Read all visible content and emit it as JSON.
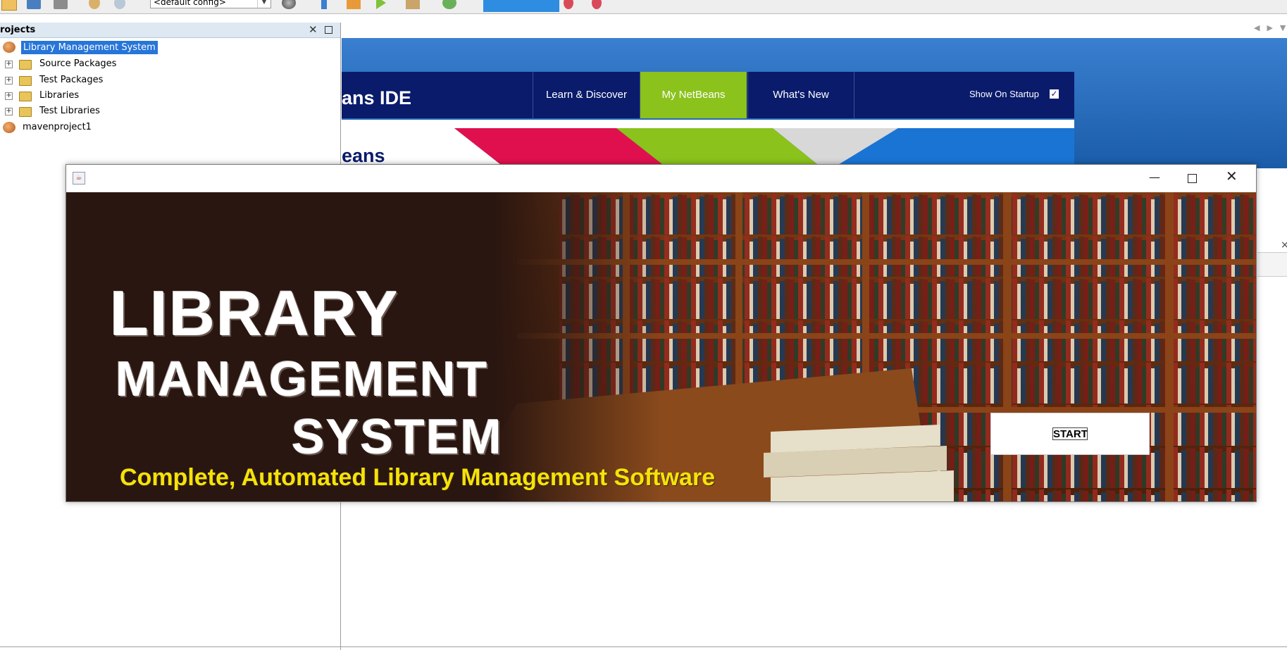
{
  "toolbar": {
    "config_value": "<default config>"
  },
  "projects_panel": {
    "title": "rojects",
    "items": [
      {
        "label": "Library Management System"
      },
      {
        "label": "Source Packages"
      },
      {
        "label": "Test Packages"
      },
      {
        "label": "Libraries"
      },
      {
        "label": "Test Libraries"
      },
      {
        "label": "mavenproject1"
      }
    ]
  },
  "start_page": {
    "brand": "ans IDE",
    "nav": [
      {
        "label": "Learn & Discover"
      },
      {
        "label": "My NetBeans"
      },
      {
        "label": "What's New"
      }
    ],
    "show_on_startup_label": "Show On Startup",
    "banner_text": "eans"
  },
  "app_window": {
    "title_line1": "LIBRARY",
    "title_line2": "MANAGEMENT",
    "title_line3": "SYSTEM",
    "tagline": "Complete, Automated Library Management Software",
    "start_label": "START"
  },
  "colors": {
    "selection": "#2675d9",
    "nav_bar": "#0a1b6b",
    "nav_active": "#8bc21c",
    "tagline": "#f5e20a"
  }
}
